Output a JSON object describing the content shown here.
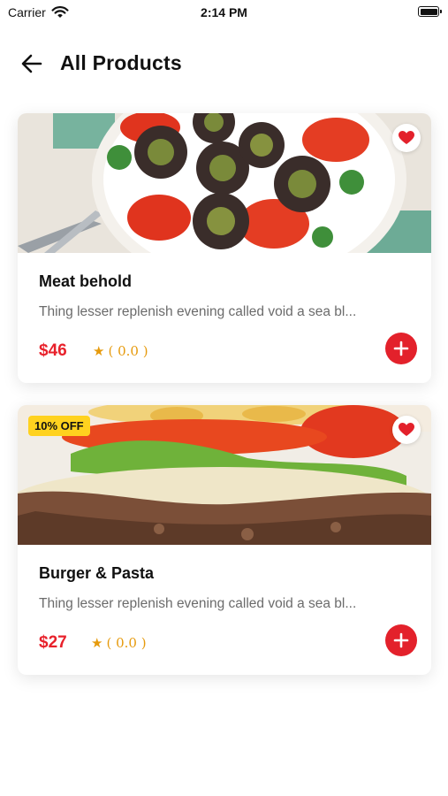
{
  "status_bar": {
    "carrier": "Carrier",
    "time": "2:14 PM"
  },
  "header": {
    "title": "All Products",
    "back_icon": "arrow-left-icon"
  },
  "colors": {
    "accent": "#e3212b",
    "price": "#e8212b",
    "rating": "#e69a0c",
    "badge": "#ffd21f"
  },
  "products": [
    {
      "name": "Meat behold",
      "description": "Thing lesser replenish evening called void a sea bl...",
      "price": "$46",
      "rating": "( 0.0 )",
      "favorite_icon": "heart-icon",
      "add_icon": "plus-icon"
    },
    {
      "name": "Burger & Pasta",
      "description": "Thing lesser replenish evening called void a sea bl...",
      "price": "$27",
      "rating": "( 0.0 )",
      "badge": "10% OFF",
      "favorite_icon": "heart-icon",
      "add_icon": "plus-icon"
    }
  ]
}
